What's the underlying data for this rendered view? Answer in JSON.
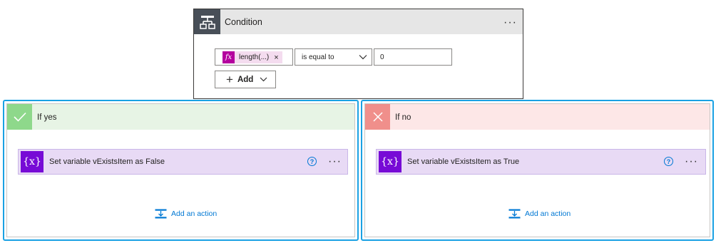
{
  "condition": {
    "title": "Condition",
    "menu_label": "···",
    "icon": "condition-icon",
    "operand_token": {
      "label": "length(...)",
      "icon": "fx-icon",
      "remove_label": "×"
    },
    "operator": "is equal to",
    "value": "0",
    "add_button_label": "Add"
  },
  "yes_branch": {
    "title": "If yes",
    "icon": "check-icon",
    "action": {
      "title": "Set variable vExistsItem as False",
      "icon": "variable-icon",
      "icon_text": "{x}",
      "help_label": "?",
      "menu_label": "···"
    },
    "add_action_label": "Add an action"
  },
  "no_branch": {
    "title": "If no",
    "icon": "close-icon",
    "action": {
      "title": "Set variable vExistsItem as True",
      "icon": "variable-icon",
      "icon_text": "{x}",
      "help_label": "?",
      "menu_label": "···"
    },
    "add_action_label": "Add an action"
  },
  "colors": {
    "branch_border": "#1aa1e3",
    "yes_accent": "#8ed88b",
    "no_accent": "#f08f8b",
    "variable_purple": "#770bd6",
    "token_magenta": "#b4009e",
    "link_blue": "#0078d4"
  }
}
